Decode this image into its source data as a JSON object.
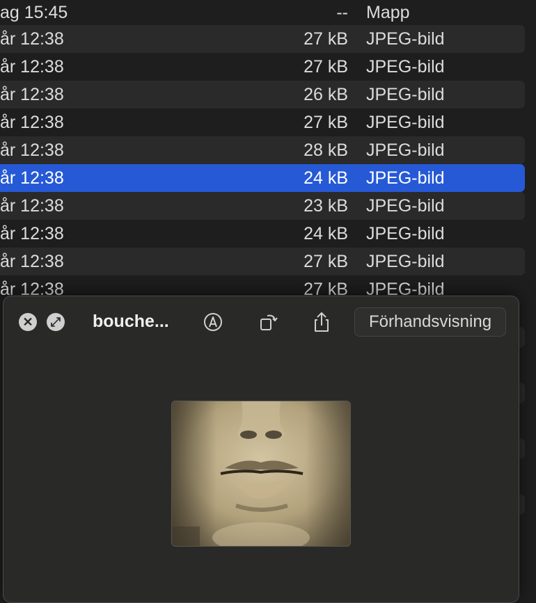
{
  "file_list": {
    "rows": [
      {
        "date": "ag 15:45",
        "size": "--",
        "kind": "Mapp"
      },
      {
        "date": "år 12:38",
        "size": "27 kB",
        "kind": "JPEG-bild"
      },
      {
        "date": "år 12:38",
        "size": "27 kB",
        "kind": "JPEG-bild"
      },
      {
        "date": "år 12:38",
        "size": "26 kB",
        "kind": "JPEG-bild"
      },
      {
        "date": "år 12:38",
        "size": "27 kB",
        "kind": "JPEG-bild"
      },
      {
        "date": "år 12:38",
        "size": "28 kB",
        "kind": "JPEG-bild"
      },
      {
        "date": "år 12:38",
        "size": "24 kB",
        "kind": "JPEG-bild",
        "selected": true
      },
      {
        "date": "år 12:38",
        "size": "23 kB",
        "kind": "JPEG-bild"
      },
      {
        "date": "år 12:38",
        "size": "24 kB",
        "kind": "JPEG-bild"
      },
      {
        "date": "år 12:38",
        "size": "27 kB",
        "kind": "JPEG-bild"
      },
      {
        "date": "år 12:38",
        "size": "27 kB",
        "kind": "JPEG-bild"
      }
    ]
  },
  "quicklook": {
    "close_icon": "✕",
    "fullscreen_icon": "⤢",
    "title": "bouche...",
    "markup_icon": "markup-pen-icon",
    "rotate_icon": "rotate-icon",
    "share_icon": "share-icon",
    "open_with_label": "Förhandsvisning"
  },
  "colors": {
    "selection": "#2659d6",
    "row_alt": "#2a2a2b",
    "panel": "#292928"
  }
}
